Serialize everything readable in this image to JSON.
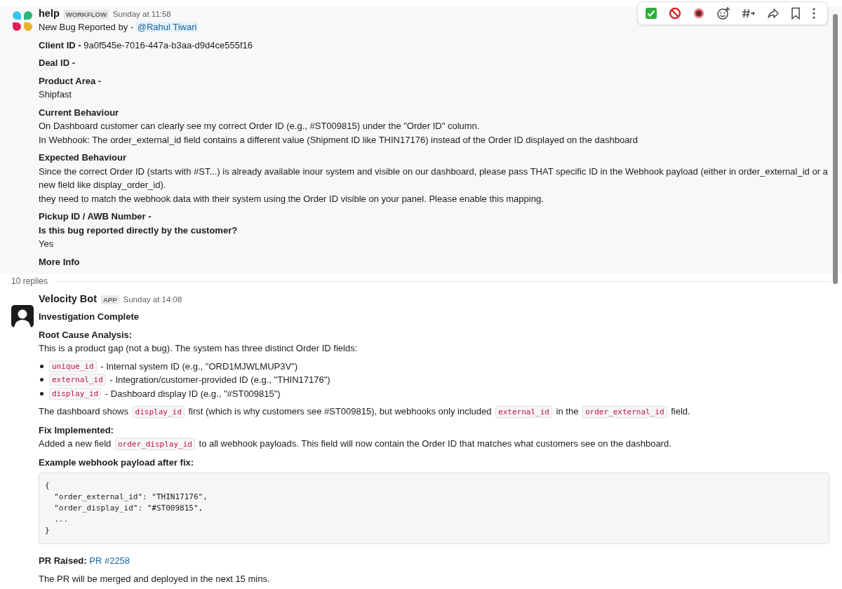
{
  "workflow_message": {
    "sender": "help",
    "badge": "WORKFLOW",
    "time": "Sunday at 11:58",
    "intro": "New Bug Reported by - ",
    "mention": "@Rahul Tiwari",
    "sections": [
      [
        {
          "kind": "rich",
          "text": "**Client ID -** 9a0f545e-7016-447a-b3aa-d9d4ce555f16"
        }
      ],
      [
        {
          "kind": "label",
          "text": "Deal ID -"
        }
      ],
      [
        {
          "kind": "label",
          "text": "Product Area -"
        },
        {
          "kind": "plain",
          "text": "Shipfast"
        }
      ],
      [
        {
          "kind": "label",
          "text": "Current Behaviour"
        },
        {
          "kind": "plain",
          "text": "On Dashboard customer can clearly see my correct Order ID (e.g., #ST009815) under the \"Order ID\" column."
        },
        {
          "kind": "plain",
          "text": "In Webhook: The order_external_id field contains a different value (Shipment ID like THIN17176) instead of the Order ID displayed on the dashboard"
        }
      ],
      [
        {
          "kind": "label",
          "text": "Expected Behaviour"
        },
        {
          "kind": "plain",
          "text": "Since the correct Order ID (starts with #ST...) is already available inour system and visible on our dashboard, please pass THAT specific ID in the Webhook payload (either in order_external_id or a new field like display_order_id)."
        },
        {
          "kind": "plain",
          "text": "they need to match the webhook data with their system using the Order ID visible on your panel. Please enable this mapping."
        }
      ],
      [
        {
          "kind": "label",
          "text": "Pickup ID / AWB Number -"
        },
        {
          "kind": "label",
          "text": "Is this bug reported directly by the customer?"
        },
        {
          "kind": "plain",
          "text": "Yes"
        }
      ],
      [
        {
          "kind": "label",
          "text": "More Info"
        }
      ]
    ]
  },
  "replies_label": "10 replies",
  "bot_message": {
    "sender": "Velocity Bot",
    "badge": "APP",
    "time": "Sunday at 14:08",
    "sections": [
      [
        {
          "kind": "label",
          "text": "Investigation Complete"
        }
      ],
      [
        {
          "kind": "label",
          "text": "Root Cause Analysis:"
        },
        {
          "kind": "plain",
          "text": "This is a product gap (not a bug). The system has three distinct Order ID fields:"
        }
      ],
      [
        {
          "kind": "bullets",
          "items": [
            [
              {
                "kind": "code",
                "text": "unique_id"
              },
              {
                "kind": "text",
                "text": " - Internal system ID (e.g., \"ORD1MJWLMUP3V\")"
              }
            ],
            [
              {
                "kind": "code",
                "text": "external_id"
              },
              {
                "kind": "text",
                "text": " - Integration/customer-provided ID (e.g., \"THIN17176\")"
              }
            ],
            [
              {
                "kind": "code",
                "text": "display_id"
              },
              {
                "kind": "text",
                "text": " - Dashboard display ID (e.g., \"#ST009815\")"
              }
            ]
          ]
        }
      ],
      [
        {
          "kind": "segments",
          "parts": [
            {
              "kind": "text",
              "text": "The dashboard shows "
            },
            {
              "kind": "code",
              "text": "display_id"
            },
            {
              "kind": "text",
              "text": " first (which is why customers see #ST009815), but webhooks only included "
            },
            {
              "kind": "code",
              "text": "external_id"
            },
            {
              "kind": "text",
              "text": " in the "
            },
            {
              "kind": "code",
              "text": "order_external_id"
            },
            {
              "kind": "text",
              "text": " field."
            }
          ]
        }
      ],
      [
        {
          "kind": "label",
          "text": "Fix Implemented:"
        },
        {
          "kind": "segments",
          "parts": [
            {
              "kind": "text",
              "text": "Added a new field "
            },
            {
              "kind": "code",
              "text": "order_display_id"
            },
            {
              "kind": "text",
              "text": " to all webhook payloads. This field will now contain the Order ID that matches what customers see on the dashboard."
            }
          ]
        }
      ],
      [
        {
          "kind": "label",
          "text": "Example webhook payload after fix:"
        },
        {
          "kind": "codeblock",
          "lines": [
            "{",
            "  \"order_external_id\": \"THIN17176\",",
            "  \"order_display_id\": \"#ST009815\",",
            "  ...",
            "}"
          ]
        }
      ],
      [
        {
          "kind": "segments",
          "parts": [
            {
              "kind": "bold",
              "text": "PR Raised: "
            },
            {
              "kind": "link",
              "text": "PR #2258"
            }
          ]
        }
      ],
      [
        {
          "kind": "plain",
          "text": "The PR will be merged and deployed in the next 15 mins."
        }
      ]
    ]
  }
}
